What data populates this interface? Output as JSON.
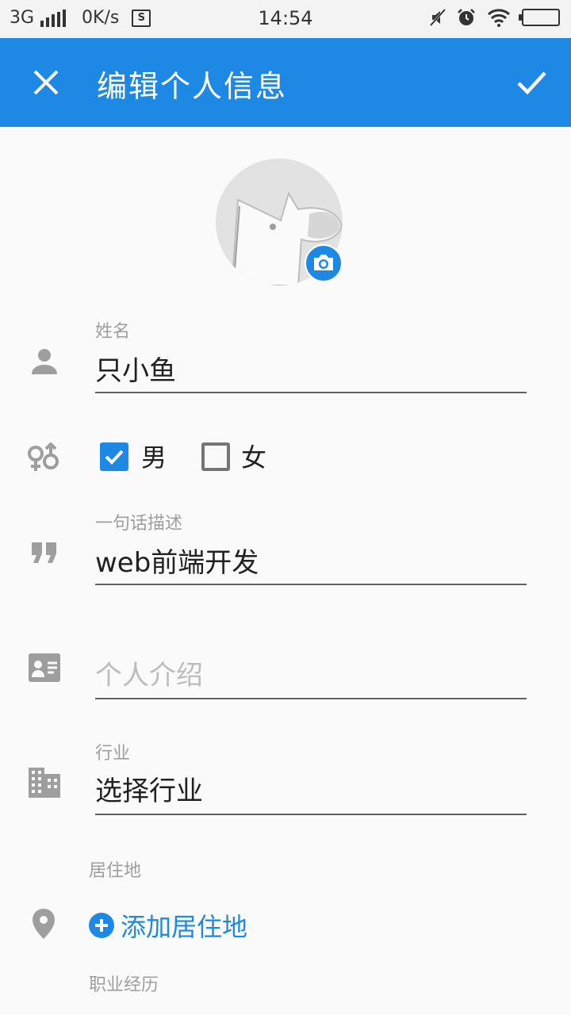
{
  "status_bar": {
    "network": "3G",
    "speed": "0K/s",
    "sd_icon_text": "S",
    "time": "14:54"
  },
  "appbar": {
    "title": "编辑个人信息",
    "bg_color": "#1e88e5"
  },
  "form": {
    "name": {
      "label": "姓名",
      "value": "只小鱼"
    },
    "gender": {
      "male_label": "男",
      "female_label": "女",
      "male_checked": true,
      "female_checked": false
    },
    "tagline": {
      "label": "一句话描述",
      "value": "web前端开发"
    },
    "intro": {
      "placeholder": "个人介绍"
    },
    "industry": {
      "label": "行业",
      "value": "选择行业"
    },
    "residence": {
      "label": "居住地",
      "add_label": "添加居住地"
    },
    "career": {
      "label": "职业经历"
    }
  },
  "icons": [
    "close-icon",
    "check-icon",
    "camera-icon",
    "person-icon",
    "gender-icon",
    "quote-icon",
    "contact-card-icon",
    "building-icon",
    "location-pin-icon",
    "plus-circle-icon"
  ]
}
